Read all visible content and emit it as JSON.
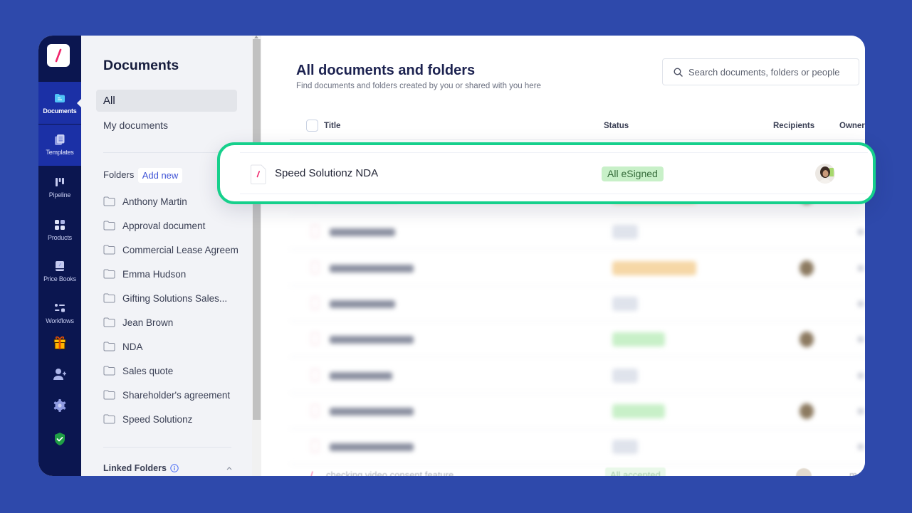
{
  "rail": {
    "logo_icon": "slash-logo-icon",
    "items": [
      {
        "label": "Documents",
        "icon": "folder-icon",
        "state": "active"
      },
      {
        "label": "Templates",
        "icon": "templates-icon",
        "state": "highlighted"
      },
      {
        "label": "Pipeline",
        "icon": "pipeline-icon",
        "state": "normal"
      },
      {
        "label": "Products",
        "icon": "products-grid-icon",
        "state": "normal"
      },
      {
        "label": "Price Books",
        "icon": "price-book-icon",
        "state": "normal"
      },
      {
        "label": "Workflows",
        "icon": "workflows-icon",
        "state": "normal"
      }
    ],
    "utility_icons": [
      "gift-icon",
      "add-user-icon",
      "gear-icon",
      "shield-check-icon"
    ]
  },
  "panel": {
    "title": "Documents",
    "nav": [
      {
        "label": "All",
        "selected": true
      },
      {
        "label": "My documents",
        "selected": false
      }
    ],
    "folders_label": "Folders",
    "add_new_label": "Add new",
    "folders": [
      "Anthony Martin",
      "Approval document",
      "Commercial Lease Agreem",
      "Emma Hudson",
      "Gifting Solutions Sales...",
      "Jean Brown",
      "NDA",
      "Sales quote",
      "Shareholder's agreement",
      "Speed Solutionz"
    ],
    "linked_folders_label": "Linked Folders"
  },
  "main": {
    "title": "All documents and folders",
    "subtitle": "Find documents and folders created by you or shared with you here",
    "search_placeholder": "Search documents, folders or people",
    "columns": {
      "title": "Title",
      "status": "Status",
      "recipients": "Recipients",
      "owner": "Owner"
    },
    "highlighted_row": {
      "title": "Speed Solutionz NDA",
      "status": "All eSigned",
      "status_kind": "signed"
    },
    "blurred_rows": [
      {
        "status_kind": "awaiting",
        "has_avatar": true
      },
      {
        "status_kind": "draft",
        "has_avatar": false
      },
      {
        "status_kind": "awaiting",
        "has_avatar": true
      },
      {
        "status_kind": "draft",
        "has_avatar": false
      },
      {
        "status_kind": "signed",
        "has_avatar": true
      },
      {
        "status_kind": "draft",
        "has_avatar": false
      },
      {
        "status_kind": "signed",
        "has_avatar": true
      },
      {
        "status_kind": "draft",
        "has_avatar": false
      }
    ],
    "last_row": {
      "title": "checking video consent feature",
      "status": "All accepted",
      "status_kind": "accepted",
      "owner": "m"
    }
  },
  "colors": {
    "page_bg": "#2e49ab",
    "rail_bg": "#0b1650",
    "rail_active_bg": "#1b30a6",
    "highlight_border": "#16d08c",
    "brand_pink": "#f0246b",
    "link_blue": "#4054d6"
  },
  "status_styles": {
    "signed": {
      "bg": "#c8f0c8",
      "fg": "#356b3a"
    },
    "accepted": {
      "bg": "#d8f4d8",
      "fg": "#5ea466"
    },
    "awaiting": {
      "bg": "#f6d7a6",
      "fg": "#a8783a"
    },
    "draft": {
      "bg": "#dfe3ec",
      "fg": "#6b7080"
    }
  }
}
